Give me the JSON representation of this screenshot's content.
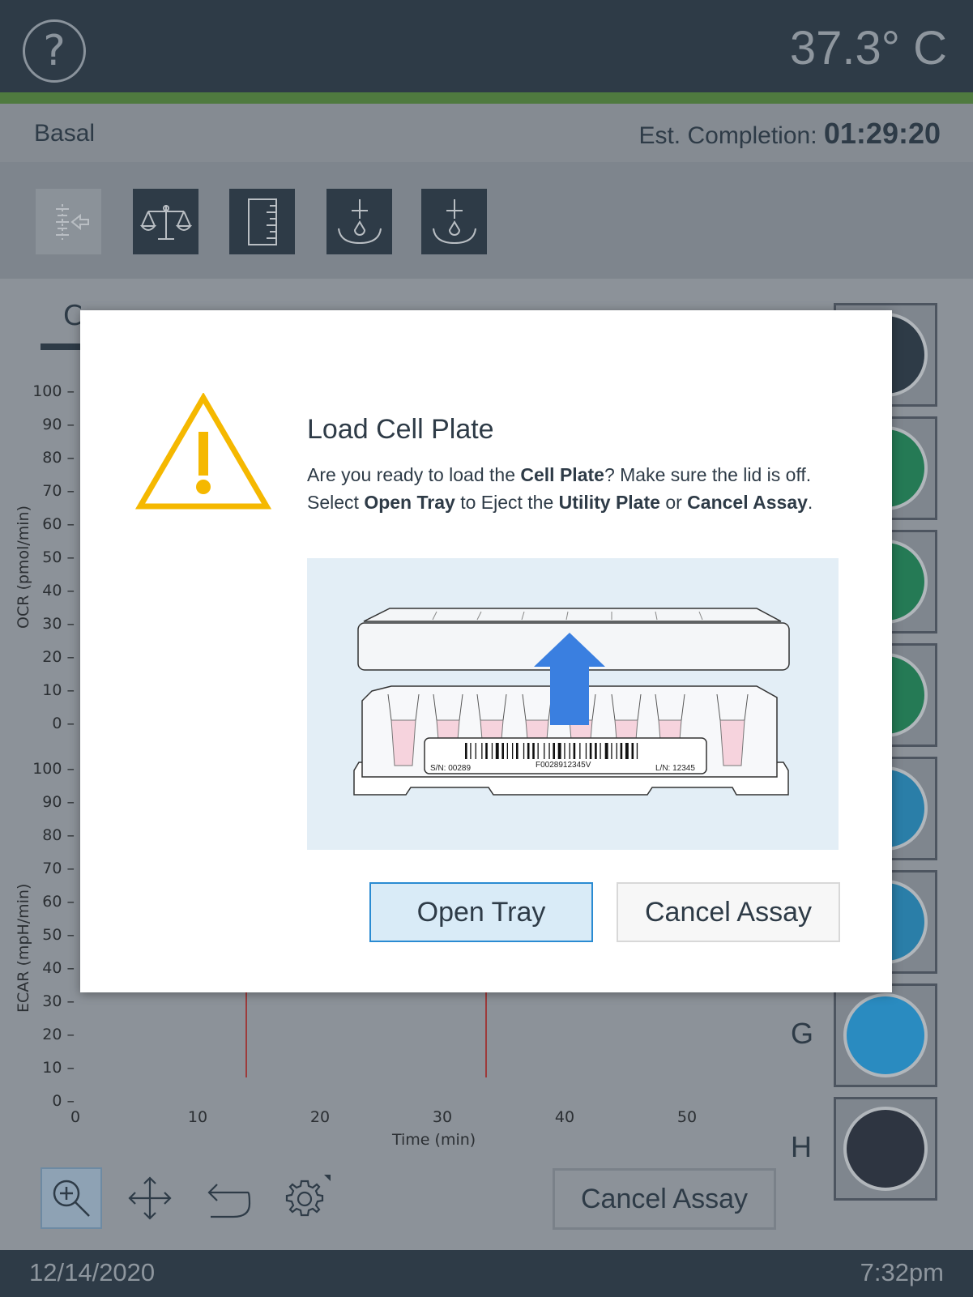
{
  "header": {
    "help_glyph": "?",
    "temperature": "37.3° C"
  },
  "status": {
    "phase": "Basal",
    "est_label": "Est. Completion:",
    "est_value": "01:29:20"
  },
  "toolbar": {
    "icons": [
      "load-icon",
      "balance-icon",
      "ruler-icon",
      "dispense-icon",
      "dispense-icon"
    ]
  },
  "chart": {
    "tab_label": "C",
    "y_ticks_ocr": [
      "100",
      "90",
      "80",
      "70",
      "60",
      "50",
      "40",
      "30",
      "20",
      "10",
      "0"
    ],
    "y_ticks_ecar": [
      "100",
      "90",
      "80",
      "70",
      "60",
      "50",
      "40",
      "30",
      "20",
      "10",
      "0"
    ],
    "x_ticks": [
      "0",
      "10",
      "20",
      "30",
      "40",
      "50"
    ],
    "ocr_label": "OCR (pmol/min)",
    "ecar_label": "ECAR (mpH/min)",
    "x_label": "Time (min)"
  },
  "wells": {
    "colors": [
      "#2e3b47",
      "#257a55",
      "#257a55",
      "#257a55",
      "#2a7ea8",
      "#2a7ea8",
      "#2a8bc0",
      "#2e3541"
    ],
    "labels": {
      "g": "G",
      "h": "H"
    }
  },
  "bottom": {
    "cancel_label": "Cancel Assay",
    "icons": [
      "zoom-icon",
      "move-icon",
      "undo-icon",
      "settings-icon"
    ]
  },
  "footer": {
    "date": "12/14/2020",
    "time": "7:32pm"
  },
  "modal": {
    "title": "Load Cell Plate",
    "body": {
      "t1": "Are you ready to load the ",
      "b1": "Cell Plate",
      "t2": "? Make sure the lid is off. Select ",
      "b2": "Open Tray",
      "t3": " to Eject the ",
      "b3": "Utility Plate",
      "t4": " or ",
      "b4": "Cancel Assay",
      "t5": "."
    },
    "barcode": {
      "sn": "S/N: 00289",
      "code": "F0028912345V",
      "ln": "L/N: 12345"
    },
    "open_label": "Open Tray",
    "cancel_label": "Cancel Assay",
    "warning_color": "#f5b800",
    "arrow_color": "#3a7fe0"
  }
}
